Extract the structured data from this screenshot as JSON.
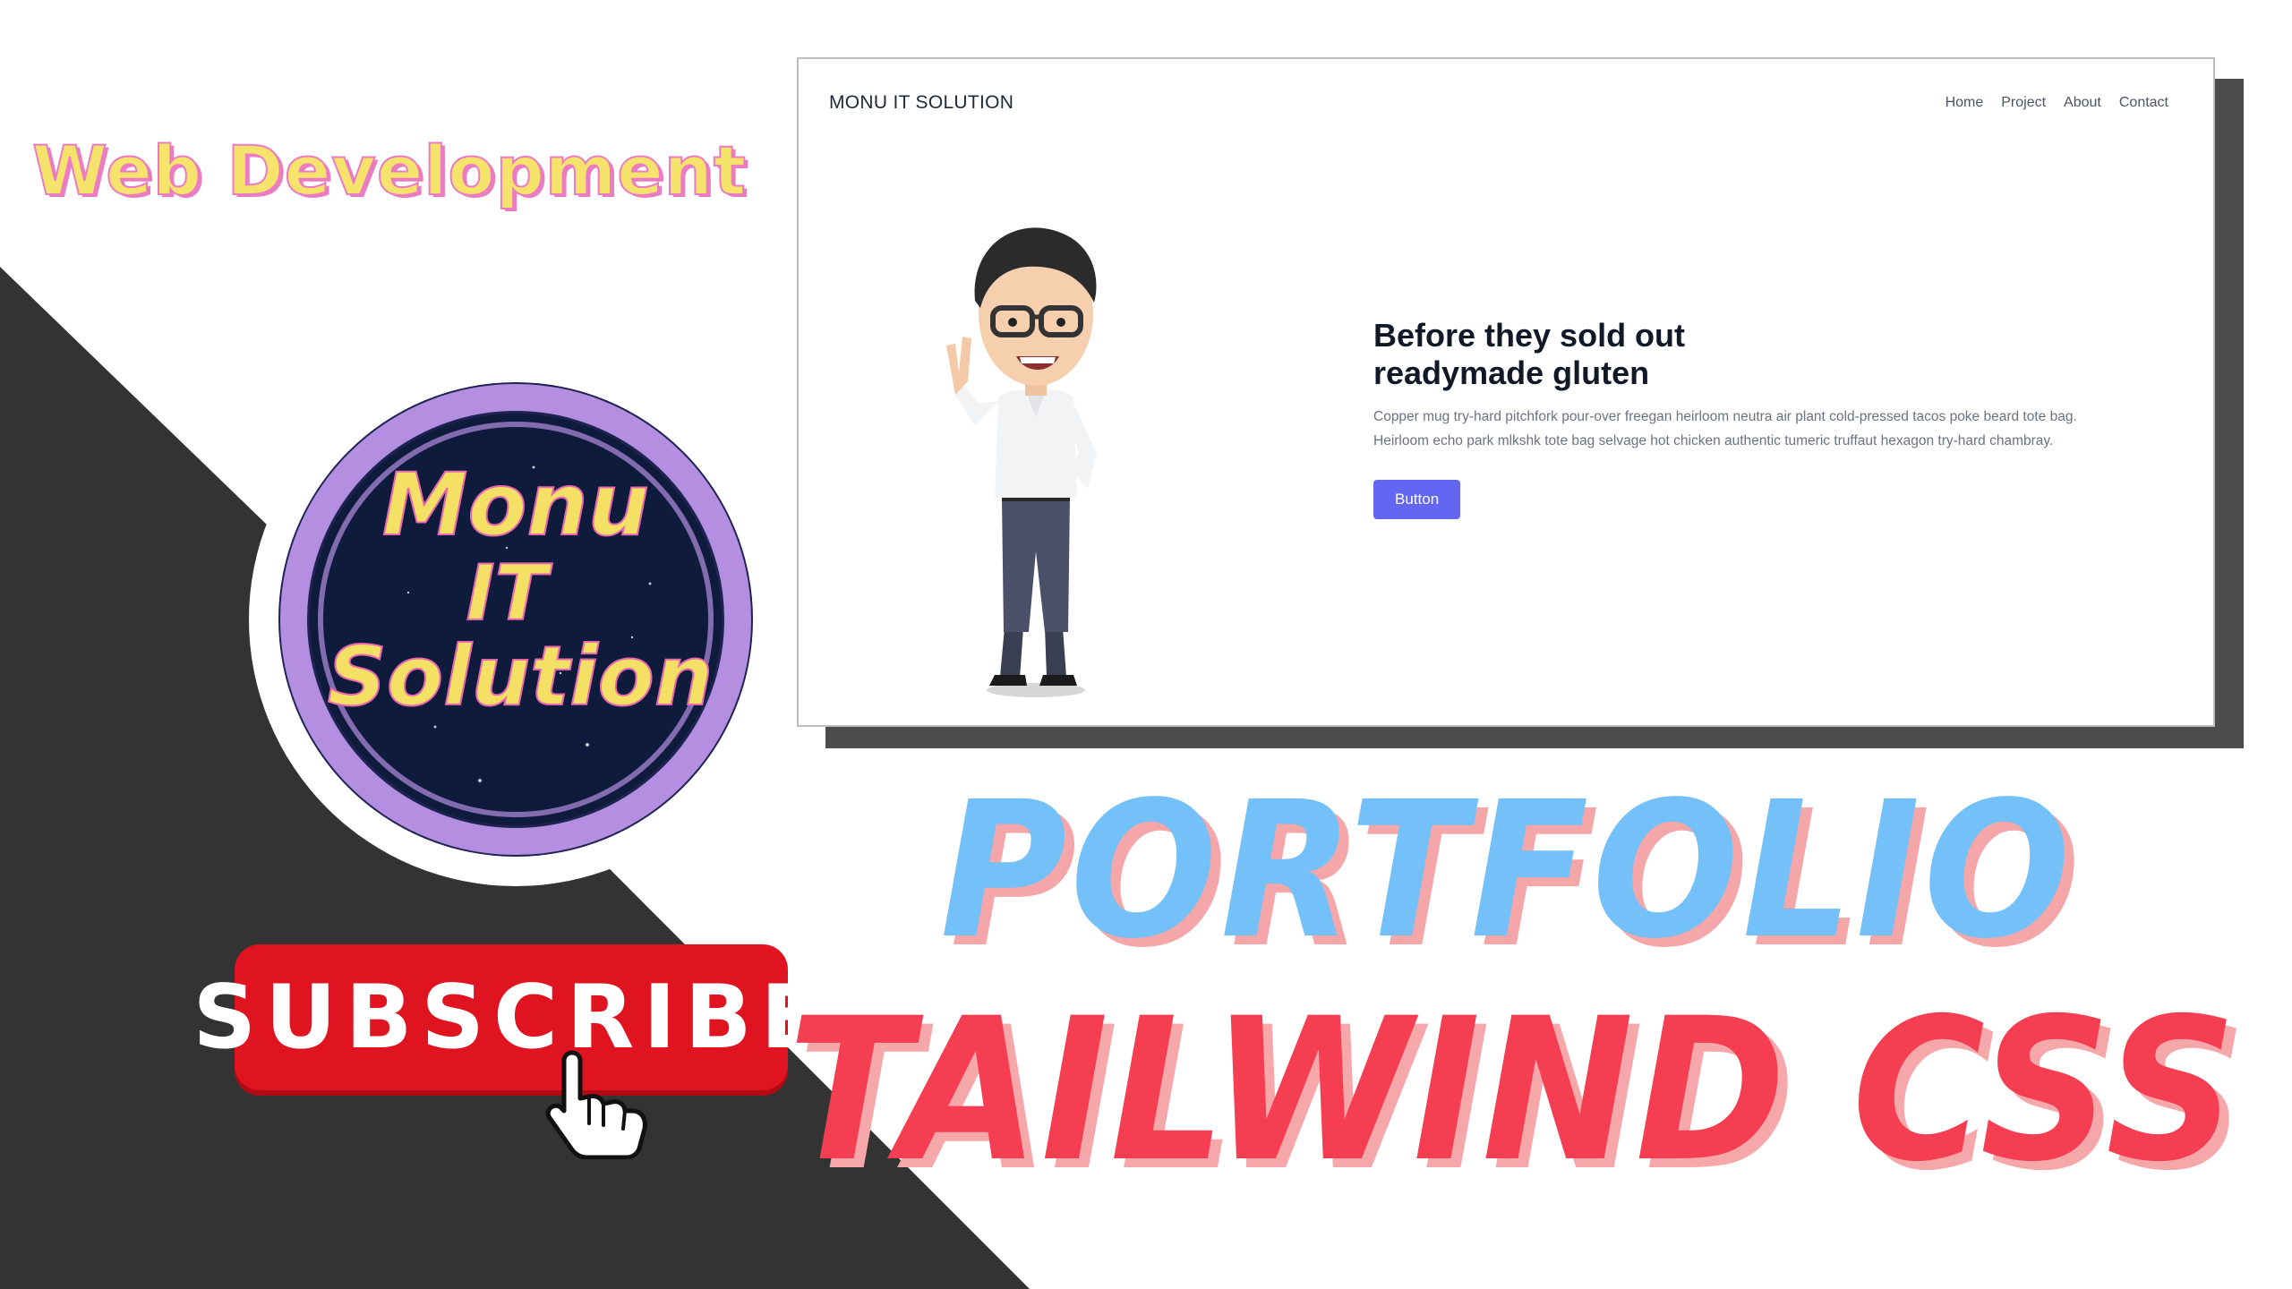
{
  "eyebrow": "Web Development",
  "logo": {
    "line1": "Monu",
    "line2": "IT",
    "line3": "Solution"
  },
  "subscribe_label": "SUBSCRIBE",
  "mockup": {
    "brand": "MONU IT SOLUTION",
    "nav": [
      "Home",
      "Project",
      "About",
      "Contact"
    ],
    "hero": {
      "title_line1": "Before they sold out",
      "title_line2": "readymade gluten",
      "desc_line1": "Copper mug try-hard pitchfork pour-over freegan heirloom neutra air plant cold-pressed tacos poke beard tote bag.",
      "desc_line2": "Heirloom echo park mlkshk tote bag selvage hot chicken authentic tumeric truffaut hexagon try-hard chambray.",
      "button": "Button"
    }
  },
  "headline1": "PORTFOLIO",
  "headline2": "TAILWIND CSS",
  "colors": {
    "dark_bg": "#333333",
    "logo_ring": "#b48ee0",
    "subscribe_red": "#e01320",
    "headline_blue": "#74c0f8",
    "headline_red": "#f53e51",
    "shadow_pink": "#f4a6a8",
    "button_indigo": "#6366f1"
  }
}
